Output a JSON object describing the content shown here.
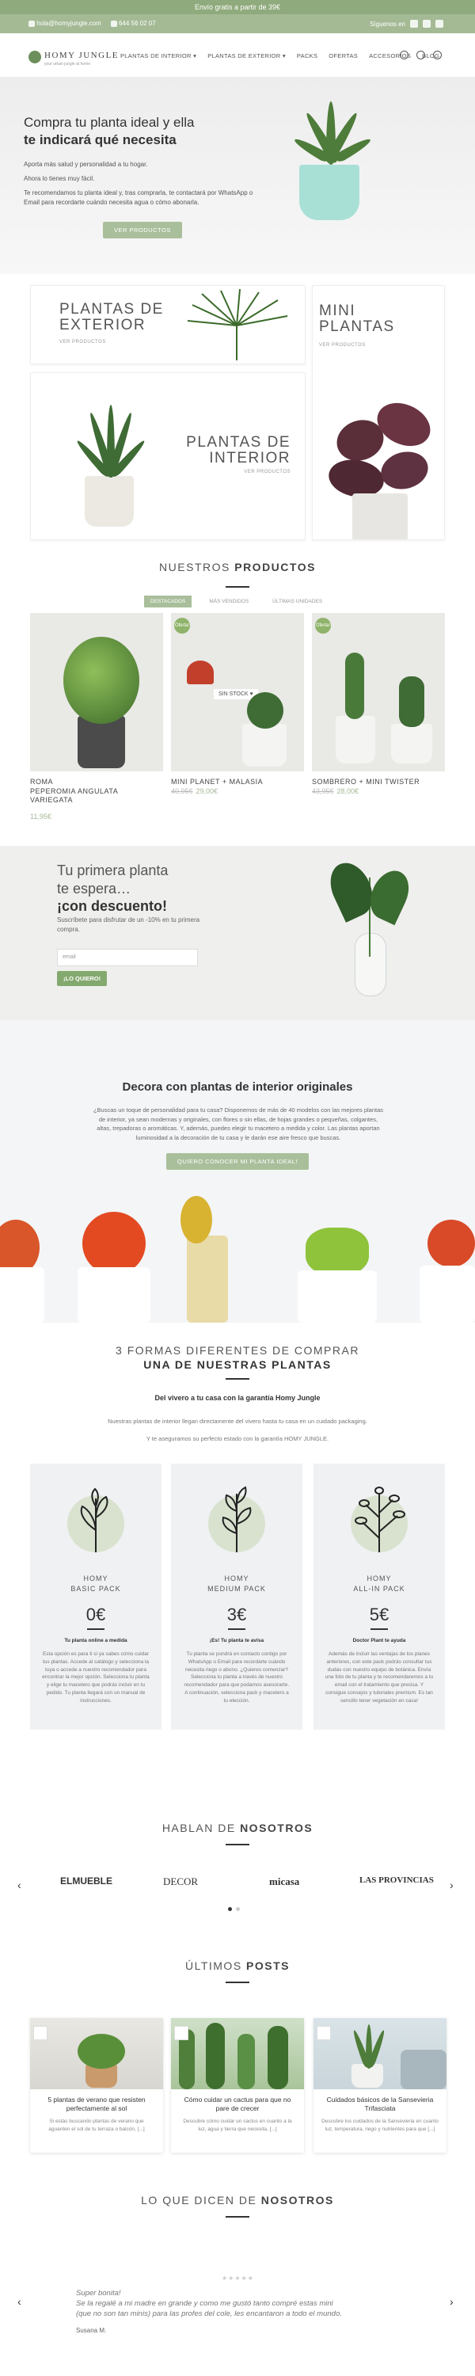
{
  "topbar": {
    "text": "Envío gratis a partir de 39€"
  },
  "contact": {
    "email": "hola@homyjungle.com",
    "phone": "644 56 02 07",
    "follow": "Síguenos en"
  },
  "header": {
    "logo_name": "HOMY JUNGLE",
    "logo_tag": "your urban jungle at home",
    "nav": [
      "PLANTAS DE INTERIOR ▾",
      "PLANTAS DE EXTERIOR ▾",
      "PACKS",
      "OFERTAS",
      "ACCESORIOS",
      "BLOG"
    ]
  },
  "hero": {
    "title_line1": "Compra tu planta ideal y ella",
    "title_line2": "te indicará qué necesita",
    "p1": "Aporta más salud y personalidad a tu hogar.",
    "p2": "Ahora lo tienes muy fácil.",
    "p3": "Te recomendamos tu planta ideal y, tras comprarla, te contactará por WhatsApp o Email para recordarte cuándo necesita agua o cómo abonarla.",
    "button": "VER PRODUCTOS"
  },
  "categories": {
    "exterior_title1": "PLANTAS DE",
    "exterior_title2": "EXTERIOR",
    "exterior_sub": "VER PRODUCTOS",
    "mini_title1": "MINI",
    "mini_title2": "PLANTAS",
    "mini_sub": "VER PRODUCTOS",
    "interior_title1": "PLANTAS DE",
    "interior_title2": "INTERIOR",
    "interior_sub": "VER PRODUCTOS"
  },
  "products_section": {
    "title_light": "NUESTROS ",
    "title_bold": "PRODUCTOS",
    "tabs": [
      "DESTACADOS",
      "MÁS VENDIDOS",
      "ÚLTIMAS UNIDADES"
    ],
    "items": [
      {
        "line1": "ROMA",
        "line2": "PEPEROMIA ANGULATA",
        "line3": "VARIEGATA",
        "old": "",
        "price": "11,95€"
      },
      {
        "line1": "MINI PLANET + MALASIA",
        "line2": "",
        "line3": "",
        "old": "40,95€",
        "price": "29,00€",
        "badge": "Oferta!",
        "nostock": "SIN STOCK ♥"
      },
      {
        "line1": "SOMBRERO + MINI TWISTER",
        "line2": "",
        "line3": "",
        "old": "43,95€",
        "price": "28,00€",
        "badge": "Oferta!"
      }
    ]
  },
  "discount": {
    "line1": "Tu primera planta",
    "line2": "te espera…",
    "line3": "¡con descuento!",
    "text": "Suscríbete para disfrutar de un -10% en tu primera compra.",
    "email_placeholder": "email",
    "button": "¡LO QUIERO!"
  },
  "decora": {
    "title": "Decora con plantas de interior originales",
    "text": "¿Buscas un toque de personalidad para tu casa? Disponemos de más de 40 modelos con las mejores plantas de interior, ya sean modernas y originales, con flores o sin ellas, de hojas grandes o pequeñas, colgantes, altas, trepadoras o aromáticas. Y, además, puedes elegir tu macetero a medida y color. Las plantas aportan luminosidad a la decoración de tu casa y le darán ese aire fresco que buscas.",
    "button": "QUIERO CONOCER MI PLANTA IDEAL!"
  },
  "ways": {
    "title1": "3 FORMAS DIFERENTES DE COMPRAR",
    "title2": "UNA DE NUESTRAS PLANTAS",
    "subtitle": "Del vivero a tu casa con la garantía Homy Jungle",
    "line1": "Nuestras plantas de interior llegan directamente del vivero hasta tu casa en un cuidado packaging.",
    "line2": "Y te aseguramos su perfecto estado con la garantía HOMY JUNGLE.",
    "packs": [
      {
        "brand": "HOMY",
        "name": "BASIC PACK",
        "price": "0€",
        "subtitle": "Tu planta online a medida",
        "desc": "Esta opción es para ti si ya sabes cómo cuidar tus plantas. Accede al catálogo y selecciona la tuya o accede a nuestro recomendador para encontrar la mejor opción. Selecciona tu planta y elige tu macetero que podrás incluir en tu pedido. Tu planta llegará con un manual de instrucciones."
      },
      {
        "brand": "HOMY",
        "name": "MEDIUM PACK",
        "price": "3€",
        "subtitle": "¡Es! Tu planta te avisa",
        "desc": "Tu planta se pondrá en contacto contigo por WhatsApp o Email para recordarte cuándo necesita riego o abono. ¿Quieres comenzar? Selecciona tu planta a través de nuestro recomendador para que podamos asesorarte. A continuación, selecciona pack y macetero a tu elección."
      },
      {
        "brand": "HOMY",
        "name": "ALL-IN PACK",
        "price": "5€",
        "subtitle": "Doctor Plant te ayuda",
        "desc": "Además de incluir las ventajas de los planes anteriores, con este pack podrás consultar tus dudas con nuestro equipo de botánica. Envía una foto de tu planta y te recomendaremos a tu email con el tratamiento que precisa. Y consigue consejos y tutoriales premium. Es tan sencillo tener vegetación en casa!"
      }
    ]
  },
  "press": {
    "title_light": "HABLAN DE ",
    "title_bold": "NOSOTROS",
    "logos": [
      "ELMUEBLE",
      "DECOR",
      "micasa",
      "LAS PROVINCIAS"
    ]
  },
  "posts": {
    "title_light": "ÚLTIMOS ",
    "title_bold": "POSTS",
    "items": [
      {
        "title": "5 plantas de verano que resisten perfectamente al sol",
        "text": "Si estás buscando plantas de verano que aguanten el sol de tu terraza o balcón, [...]"
      },
      {
        "title": "Cómo cuidar un cactus para que no pare de crecer",
        "text": "Descubre cómo cuidar un cactus en cuanto a la luz, agua y tierra que necesita, [...]"
      },
      {
        "title": "Cuidados básicos de la Sansevieria Trifasciata",
        "text": "Descubre los cuidados de la Sansevieria en cuanto luz, temperatura, riego y nutrientes para que [...]"
      }
    ]
  },
  "testimonials": {
    "title_light": "LO QUE DICEN DE ",
    "title_bold": "NOSOTROS",
    "stars": "★★★★★",
    "quote1": "Super bonita!",
    "quote2": "Se la regalé a mi madre en grande y como me gustó tanto compré estas mini",
    "quote3": "(que no son tan minis) para las profes del cole, les encantaron a todo el mundo.",
    "author": "Susana M."
  },
  "colors": {
    "brand_green": "#8faa7c",
    "accent": "#a9bf9b",
    "button": "#84a96e"
  }
}
